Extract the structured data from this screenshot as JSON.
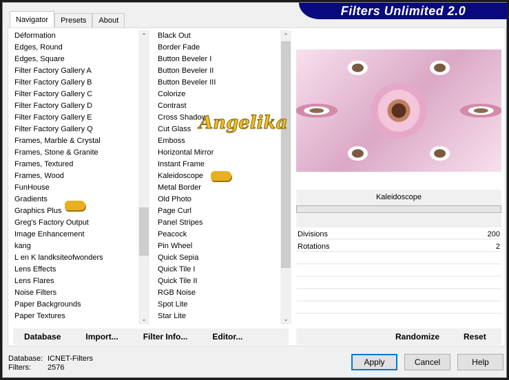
{
  "title": "Filters Unlimited 2.0",
  "tabs": [
    "Navigator",
    "Presets",
    "About"
  ],
  "categories": [
    "Déformation",
    "Edges, Round",
    "Edges, Square",
    "Filter Factory Gallery A",
    "Filter Factory Gallery B",
    "Filter Factory Gallery C",
    "Filter Factory Gallery D",
    "Filter Factory Gallery E",
    "Filter Factory Gallery Q",
    "Frames, Marble & Crystal",
    "Frames, Stone & Granite",
    "Frames, Textured",
    "Frames, Wood",
    "FunHouse",
    "Gradients",
    "Graphics Plus",
    "Greg's Factory Output",
    "Image Enhancement",
    "kang",
    "L en K landksiteofwonders",
    "Lens Effects",
    "Lens Flares",
    "Noise Filters",
    "Paper Backgrounds",
    "Paper Textures"
  ],
  "filters": [
    "Black Out",
    "Border Fade",
    "Button Beveler I",
    "Button Beveler II",
    "Button Beveler III",
    "Colorize",
    "Contrast",
    "Cross Shadow",
    "Cut Glass",
    "Emboss",
    "Horizontal Mirror",
    "Instant Frame",
    "Kaleidoscope",
    "Metal Border",
    "Old Photo",
    "Page Curl",
    "Panel Stripes",
    "Peacock",
    "Pin Wheel",
    "Quick Sepia",
    "Quick Tile I",
    "Quick Tile II",
    "RGB Noise",
    "Spot Lite",
    "Star Lite"
  ],
  "selected_category": "Graphics Plus",
  "selected_filter": "Kaleidoscope",
  "buttons": {
    "database": "Database",
    "import": "Import...",
    "filter_info": "Filter Info...",
    "editor": "Editor...",
    "randomize": "Randomize",
    "reset": "Reset",
    "apply": "Apply",
    "cancel": "Cancel",
    "help": "Help"
  },
  "filter_name": "Kaleidoscope",
  "params": [
    {
      "label": "Divisions",
      "value": "200"
    },
    {
      "label": "Rotations",
      "value": "2"
    }
  ],
  "status": {
    "database_label": "Database:",
    "database_value": "ICNET-Filters",
    "filters_label": "Filters:",
    "filters_value": "2576"
  },
  "watermark": "Angelika"
}
